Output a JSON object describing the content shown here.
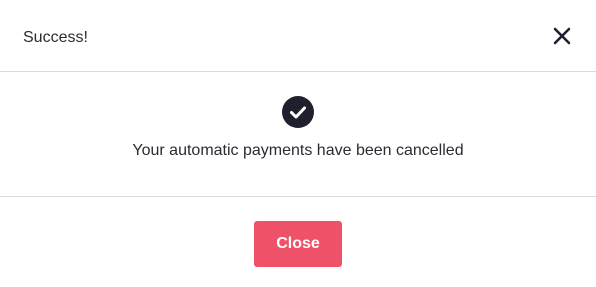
{
  "dialog": {
    "title": "Success!",
    "close_icon": "close-x-icon",
    "status_icon": "check-circle-icon",
    "message": "Your automatic payments have been cancelled",
    "close_button_label": "Close",
    "colors": {
      "primary": "#ef5268",
      "text": "#2b2b33",
      "icon": "#1f1f2e",
      "divider": "#d9d9de"
    }
  }
}
